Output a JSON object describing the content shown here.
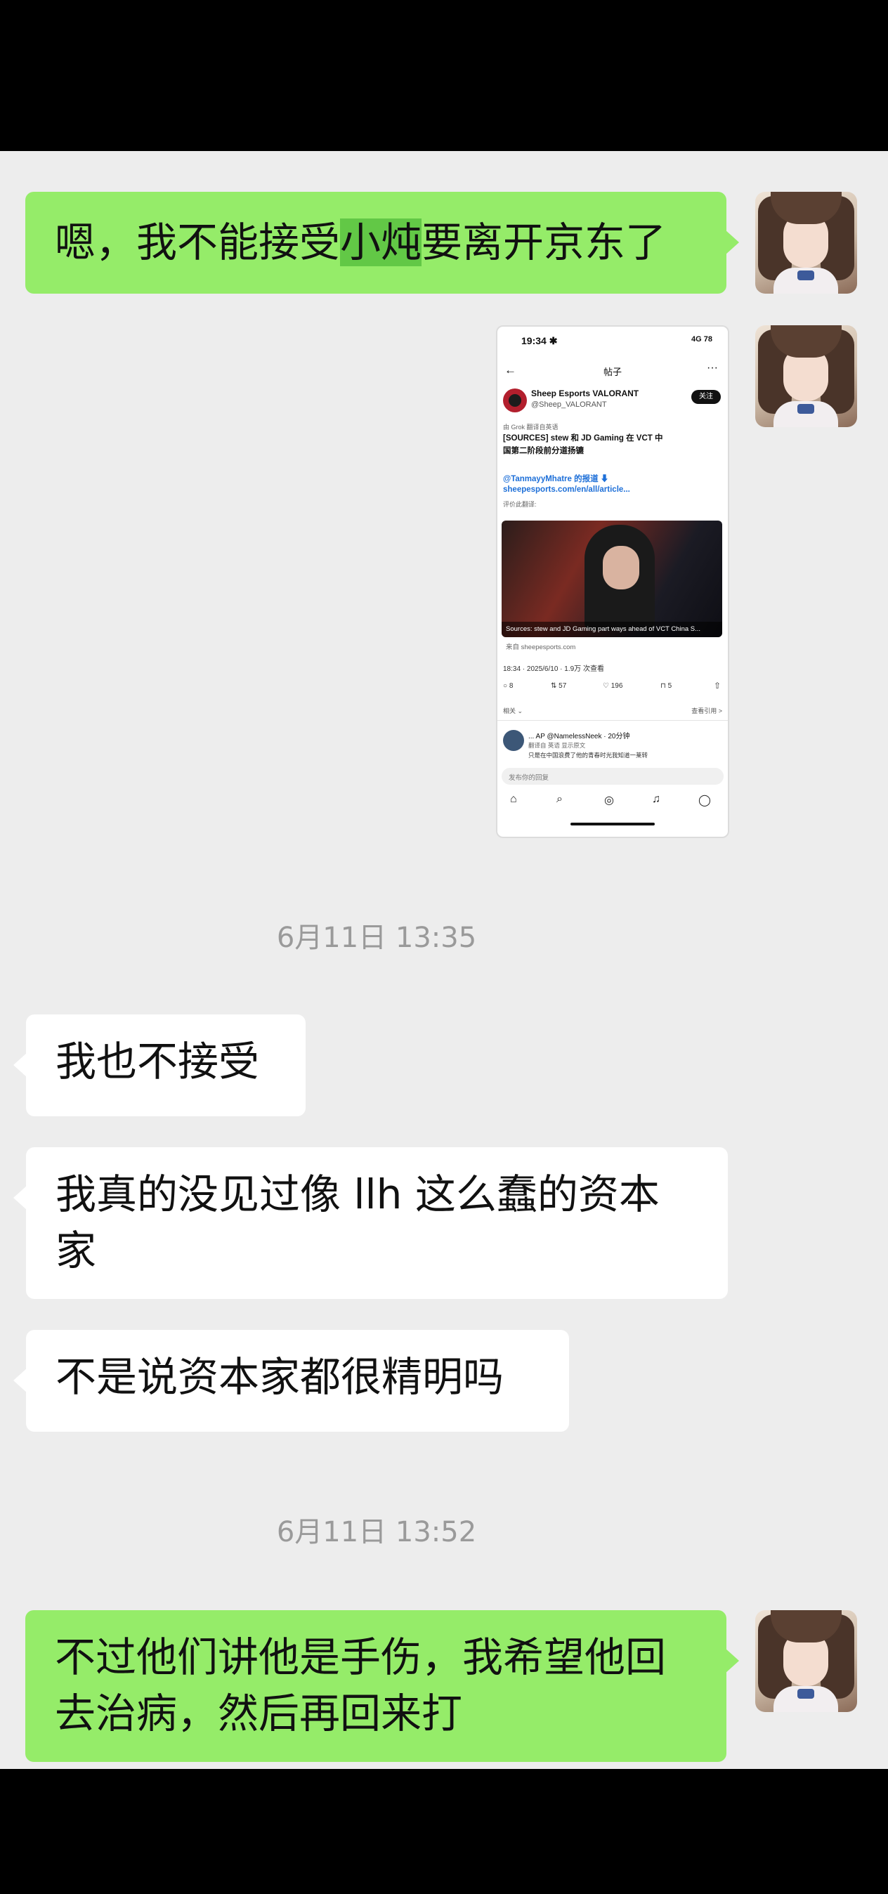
{
  "messages": {
    "m1": {
      "before": "嗯，我不能接受",
      "highlight": "小炖",
      "after": "要离开京东了"
    },
    "m3": "我也不接受",
    "m4": "我真的没见过像 llh 这么蠢的资本家",
    "m5": "不是说资本家都很精明吗",
    "m6": "不过他们讲他是手伤，我希望他回去治病，然后再回来打"
  },
  "timestamps": [
    "6月11日 13:35",
    "6月11日 13:52"
  ],
  "shared_screenshot": {
    "status_time": "19:34 ✱",
    "status_right": "4G 78",
    "nav_title": "帖子",
    "account_name": "Sheep Esports VALORANT",
    "account_handle": "@Sheep_VALORANT",
    "follow_label": "关注",
    "grok_note": "由 Grok 翻译自英语",
    "tweet_line1": "[SOURCES] stew 和 JD Gaming 在 VCT 中",
    "tweet_line2": "国第二阶段前分道扬镳",
    "link_line1": "@TanmayyMhatre 的报道 ⬇",
    "link_line2": "sheepesports.com/en/all/article...",
    "translate_note": "评价此翻译:",
    "image_caption": "Sources: stew and JD Gaming part ways ahead of VCT China S...",
    "source": "来自 sheepesports.com",
    "meta": "18:34 · 2025/6/10 · 1.9万 次查看",
    "stats": {
      "reply": "8",
      "retweet": "57",
      "like": "196",
      "bookmark": "5"
    },
    "related_label": "相关 ⌄",
    "related_right": "查看引用 >",
    "reply_user": "... AP @NamelessNeek · 20分钟",
    "reply_sub": "翻译自 英语 显示原文",
    "reply_text": "只是在中国浪费了他的青春时光我知道一莱转",
    "reply_placeholder": "发布你的回复"
  },
  "icons": {
    "back": "←",
    "more": "···",
    "reply": "○",
    "retweet": "⇅",
    "like": "♡",
    "bookmark": "⊓",
    "share": "⇧",
    "tabs": [
      "⌂",
      "⌕",
      "◎",
      "♫",
      "◯"
    ]
  },
  "colors": {
    "sent_bubble": "#95ec69",
    "received_bubble": "#ffffff",
    "highlight": "#62c846",
    "background": "#ededed"
  }
}
